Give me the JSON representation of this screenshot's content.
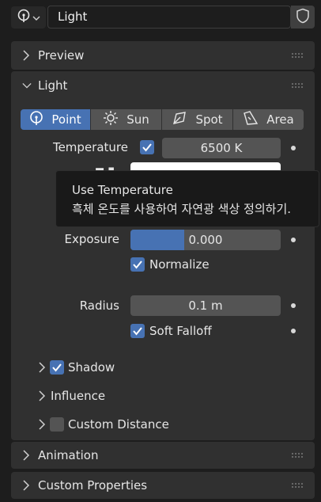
{
  "header": {
    "name": "Light"
  },
  "panels": {
    "preview": "Preview",
    "light": "Light",
    "animation": "Animation",
    "custom_properties": "Custom Properties"
  },
  "light_types": [
    {
      "label": "Point",
      "icon": "point-light-icon",
      "active": true
    },
    {
      "label": "Sun",
      "icon": "sun-icon",
      "active": false
    },
    {
      "label": "Spot",
      "icon": "spot-light-icon",
      "active": false
    },
    {
      "label": "Area",
      "icon": "area-light-icon",
      "active": false
    }
  ],
  "properties": {
    "temperature_label": "Temperature",
    "temperature_value": "6500 K",
    "temperature_checked": true,
    "exposure_label": "Exposure",
    "exposure_value": "0.000",
    "normalize_label": "Normalize",
    "normalize_checked": true,
    "radius_label": "Radius",
    "radius_value": "0.1 m",
    "soft_falloff_label": "Soft Falloff",
    "soft_falloff_checked": true
  },
  "subpanels": {
    "shadow": "Shadow",
    "shadow_checked": true,
    "influence": "Influence",
    "custom_distance": "Custom Distance",
    "custom_distance_checked": false
  },
  "tooltip": {
    "title": "Use Temperature",
    "description": "흑체 온도를 사용하여 자연광 색상 정의하기."
  },
  "colors": {
    "accent": "#4772b3",
    "panel": "#303030",
    "field": "#545454",
    "background": "#1d1d1d"
  }
}
